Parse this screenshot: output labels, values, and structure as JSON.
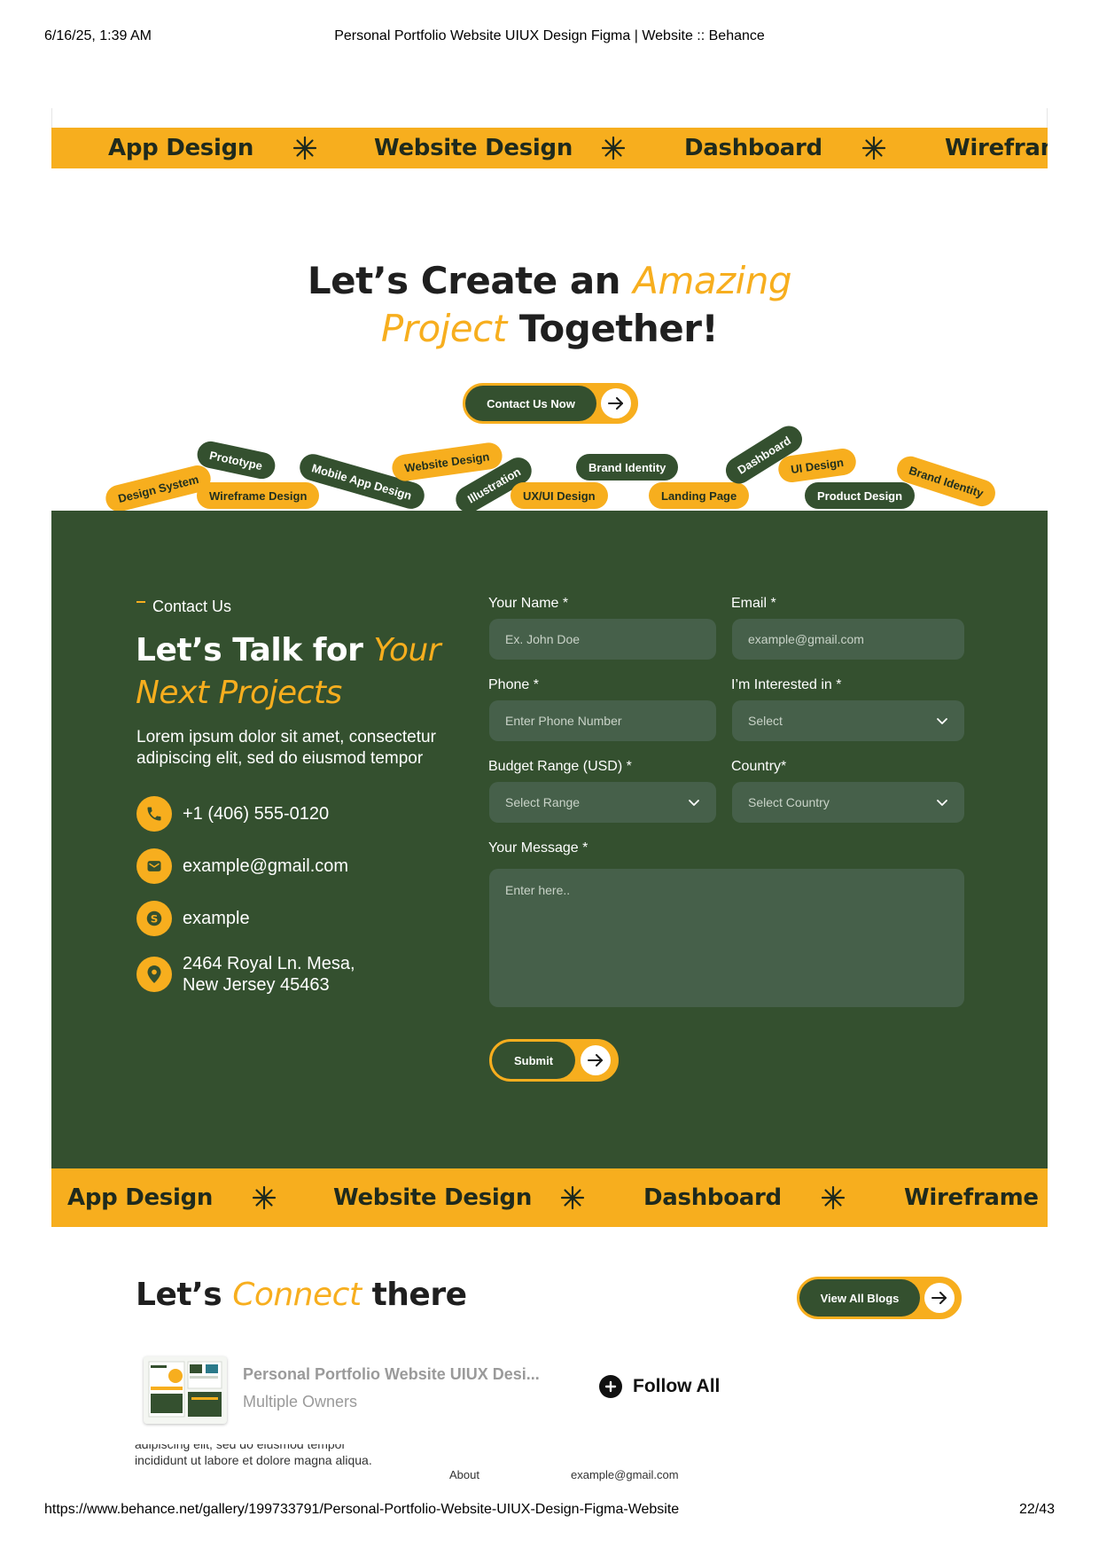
{
  "print_header": {
    "datetime": "6/16/25, 1:39 AM",
    "page_title": "Personal Portfolio Website UIUX Design Figma | Website :: Behance"
  },
  "marquee_top": [
    "App Design",
    "Website Design",
    "Dashboard",
    "Wirefram"
  ],
  "hero": {
    "line1_pre": "Let’s Create an ",
    "line1_accent": "Amazing",
    "line2_accent": "Project",
    "line2_post": " Together!",
    "cta_label": "Contact Us Now"
  },
  "tags": [
    {
      "label": "Design System",
      "style": "yellow"
    },
    {
      "label": "Prototype",
      "style": "green"
    },
    {
      "label": "Wireframe Design",
      "style": "yellow"
    },
    {
      "label": "Mobile App Design",
      "style": "green"
    },
    {
      "label": "Website Design",
      "style": "yellow"
    },
    {
      "label": "Illustration",
      "style": "green"
    },
    {
      "label": "UX/UI Design",
      "style": "yellow"
    },
    {
      "label": "Brand Identity",
      "style": "green"
    },
    {
      "label": "Landing Page",
      "style": "yellow"
    },
    {
      "label": "Dashboard",
      "style": "green"
    },
    {
      "label": "UI Design",
      "style": "yellow"
    },
    {
      "label": "Product Design",
      "style": "green"
    },
    {
      "label": "Brand Identity",
      "style": "yellow"
    }
  ],
  "contact": {
    "eyebrow": "Contact Us",
    "title_pre": "Let’s Talk for ",
    "title_accent": "Your Next Projects",
    "description": "Lorem ipsum dolor sit amet, consectetur adipiscing elit, sed do eiusmod tempor",
    "phone": "+1 (406) 555-0120",
    "email": "example@gmail.com",
    "skype": "example",
    "address": "2464 Royal Ln. Mesa, New Jersey 45463"
  },
  "form": {
    "name_label": "Your Name *",
    "name_placeholder": "Ex. John Doe",
    "email_label": "Email *",
    "email_placeholder": "example@gmail.com",
    "phone_label": "Phone *",
    "phone_placeholder": "Enter Phone Number",
    "interest_label": "I’m Interested in *",
    "interest_value": "Select",
    "budget_label": "Budget Range (USD) *",
    "budget_value": "Select Range",
    "country_label": "Country*",
    "country_value": "Select Country",
    "message_label": "Your Message *",
    "message_placeholder": "Enter here..",
    "submit_label": "Submit"
  },
  "marquee_bottom": [
    "App Design",
    "Website Design",
    "Dashboard",
    "Wireframe"
  ],
  "connect": {
    "title_pre": "Let’s ",
    "title_accent": "Connect",
    "title_post": " there",
    "view_blogs_label": "View All Blogs"
  },
  "behance_bar": {
    "project_title": "Personal Portfolio Website UIUX Desi...",
    "owners": "Multiple Owners",
    "follow_label": "Follow All"
  },
  "footer_partial": {
    "text_line1": "adipiscing elit, sed do eiusmod tempor",
    "text_line2": "incididunt ut labore et dolore magna aliqua.",
    "about": "About",
    "email": "example@gmail.com"
  },
  "print_footer": {
    "url": "https://www.behance.net/gallery/199733791/Personal-Portfolio-Website-UIUX-Design-Figma-Website",
    "page": "22/43"
  },
  "colors": {
    "accent": "#F7AE1E",
    "dark_green": "#34502F",
    "field_bg": "#46604A"
  }
}
